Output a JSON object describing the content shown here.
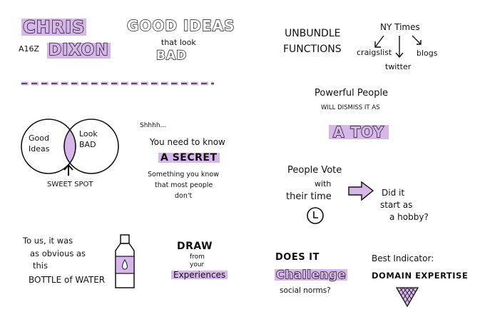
{
  "speaker": {
    "first": "CHRIS",
    "last": "DIXON",
    "org": "A16Z"
  },
  "title": {
    "line1": "GOOD IDEAS",
    "line2": "that look",
    "line3": "BAD"
  },
  "venn": {
    "left": "Good\nIdeas",
    "right": "Look\nBAD",
    "caption": "SWEET SPOT"
  },
  "secret": {
    "hush": "Shhhh...",
    "line1": "You need to know",
    "big": "A SECRET",
    "sub1": "Something you know",
    "sub2": "that most people",
    "sub3": "don't"
  },
  "water": {
    "line1": "To us, it was",
    "line2": "as obvious as",
    "line3": "this",
    "line4": "BOTTLE of WATER"
  },
  "draw": {
    "line1": "DRAW",
    "line2": "from",
    "line3": "your",
    "line4": "Experiences"
  },
  "unbundle": {
    "line1": "UNBUNDLE",
    "line2": "FUNCTIONS",
    "nyt": "NY Times",
    "craigslist": "craigslist",
    "blogs": "blogs",
    "twitter": "twitter"
  },
  "toy": {
    "line1": "Powerful People",
    "line2": "WILL DISMISS IT AS",
    "big": "A TOY"
  },
  "vote": {
    "line1": "People Vote",
    "line2": "with",
    "line3": "their time",
    "q1": "Did it",
    "q2": "start as",
    "q3": "a hobby?"
  },
  "challenge": {
    "line1": "DOES IT",
    "big": "Challenge",
    "line3": "social norms?"
  },
  "indicator": {
    "line1": "Best Indicator:",
    "line2": "DOMAIN EXPERTISE"
  },
  "colors": {
    "accent": "#d7b6ea",
    "ink": "#111111"
  }
}
